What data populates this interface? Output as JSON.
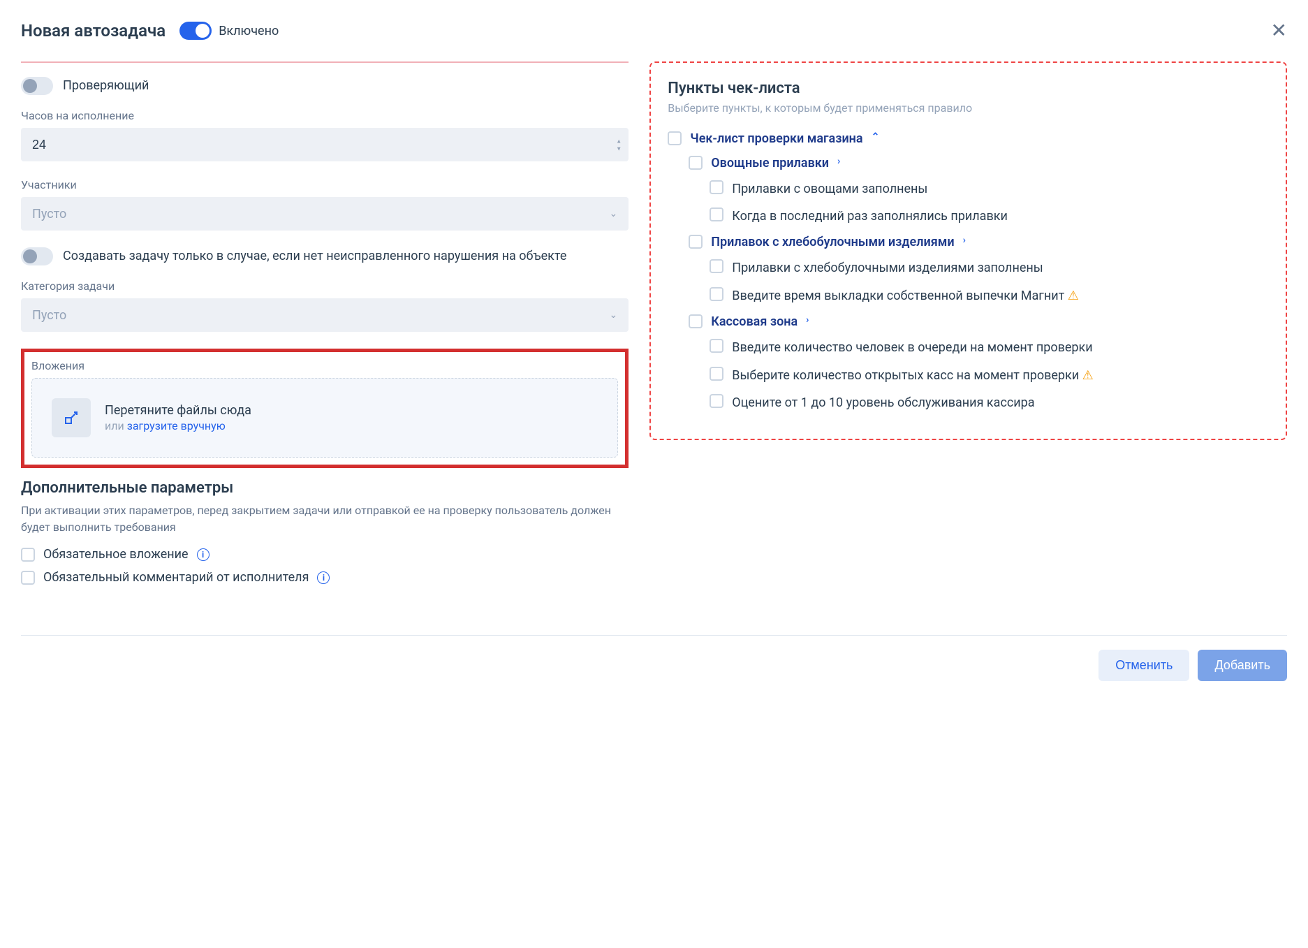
{
  "header": {
    "title": "Новая автозадача",
    "toggle_label": "Включено"
  },
  "left": {
    "reviewer_label": "Проверяющий",
    "hours_label": "Часов на исполнение",
    "hours_value": "24",
    "participants_label": "Участники",
    "participants_placeholder": "Пусто",
    "create_only_if_label": "Создавать задачу только в случае, если нет неисправленного нарушения на объекте",
    "category_label": "Категория задачи",
    "category_placeholder": "Пусто",
    "attachments_label": "Вложения",
    "dropzone_title": "Перетяните файлы сюда",
    "dropzone_or": "или ",
    "dropzone_link": "загрузите вручную",
    "additional_title": "Дополнительные параметры",
    "additional_desc": "При активации этих параметров, перед закрытием задачи или отправкой ее на проверку пользователь должен будет выполнить требования",
    "required_attachment": "Обязательное вложение",
    "required_comment": "Обязательный комментарий от исполнителя"
  },
  "checklist": {
    "title": "Пункты чек-листа",
    "desc": "Выберите пункты, к которым будет применяться правило",
    "root": {
      "label": "Чек-лист проверки магазина",
      "children": [
        {
          "label": "Овощные прилавки",
          "items": [
            "Прилавки с овощами заполнены",
            "Когда в последний раз заполнялись прилавки"
          ]
        },
        {
          "label": "Прилавок с хлебобулочными изделиями",
          "items": [
            "Прилавки с хлебобулочными изделиями заполнены",
            "Введите время выкладки собственной выпечки Магнит"
          ],
          "warnings": [
            false,
            true
          ]
        },
        {
          "label": "Кассовая зона",
          "items": [
            "Введите количество человек в очереди на момент проверки",
            "Выберите количество открытых касс на момент проверки",
            "Оцените от 1 до 10 уровень обслуживания кассира"
          ],
          "warnings": [
            false,
            true,
            false
          ]
        }
      ]
    }
  },
  "footer": {
    "cancel": "Отменить",
    "add": "Добавить"
  }
}
